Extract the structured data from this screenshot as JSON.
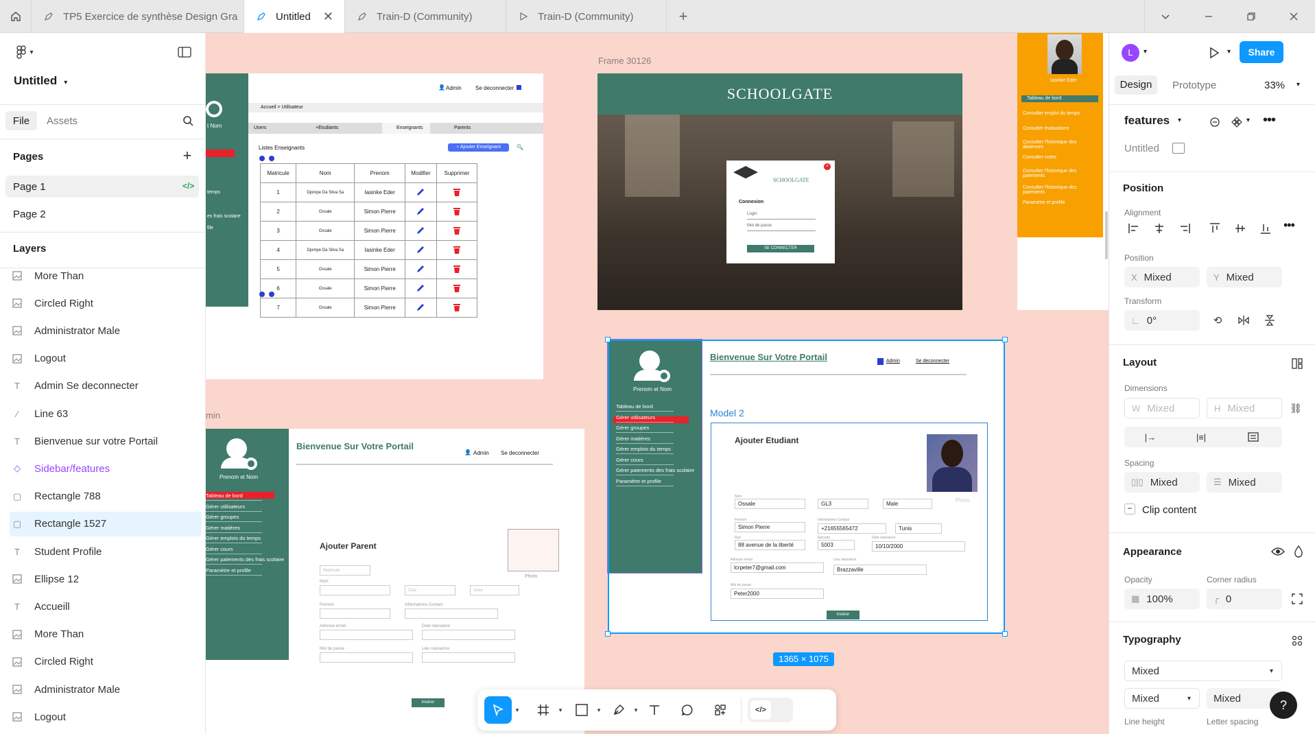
{
  "tabs": [
    {
      "label": "TP5 Exercice de synthèse Design Gra",
      "active": false
    },
    {
      "label": "Untitled",
      "active": true
    },
    {
      "label": "Train-D (Community)",
      "active": false
    },
    {
      "label": "Train-D (Community)",
      "active": false
    }
  ],
  "file": {
    "title": "Untitled"
  },
  "panel_tabs": {
    "file": "File",
    "assets": "Assets"
  },
  "pages": {
    "heading": "Pages",
    "items": [
      "Page 1",
      "Page 2"
    ]
  },
  "layers": {
    "heading": "Layers",
    "items": [
      {
        "label": "More Than",
        "icon": "image"
      },
      {
        "label": "Circled Right",
        "icon": "image"
      },
      {
        "label": "Administrator Male",
        "icon": "image"
      },
      {
        "label": "Logout",
        "icon": "image"
      },
      {
        "label": "Admin Se deconnecter",
        "icon": "text"
      },
      {
        "label": "Line 63",
        "icon": "line"
      },
      {
        "label": "Bienvenue sur votre Portail",
        "icon": "text"
      },
      {
        "label": "Sidebar/features",
        "icon": "component"
      },
      {
        "label": "Rectangle 788",
        "icon": "rect"
      },
      {
        "label": "Rectangle 1527",
        "icon": "rect"
      },
      {
        "label": "Student Profile",
        "icon": "text"
      },
      {
        "label": "Ellipse 12",
        "icon": "image"
      },
      {
        "label": "Accueill",
        "icon": "text"
      },
      {
        "label": "More Than",
        "icon": "image"
      },
      {
        "label": "Circled Right",
        "icon": "image"
      },
      {
        "label": "Administrator Male",
        "icon": "image"
      },
      {
        "label": "Logout",
        "icon": "image"
      }
    ]
  },
  "canvas": {
    "frame_label": "Frame 30126",
    "frame_label_2": "min",
    "size_badge": "1365 × 1075",
    "users_frame": {
      "header_admin": "Admin",
      "header_logout": "Se deconnecter",
      "breadcrumb": "Accueil > Utilisateur",
      "tabs": [
        "Users",
        "+Etudiants",
        "Enseignants",
        "Parents"
      ],
      "list_title": "Listes Enseignants",
      "add_button": "+ Ajouter Enseignant",
      "columns": [
        "Matricule",
        "Nom",
        "Prenom",
        "Modifier",
        "Supprimer"
      ],
      "rows": [
        [
          "1",
          "Djompe Da Silva Sa",
          "Iasinke Eder"
        ],
        [
          "2",
          "Ossale",
          "Simon Pierre"
        ],
        [
          "3",
          "Ossale",
          "Simon Pierre"
        ],
        [
          "4",
          "Djompe Da Silva Sa",
          "Iasinke Eder"
        ],
        [
          "5",
          "Ossale",
          "Simon Pierre"
        ],
        [
          "6",
          "Ossale",
          "Simon Pierre"
        ],
        [
          "7",
          "Ossale",
          "Simon Pierre"
        ]
      ],
      "sidebar_partial": [
        "t Nom",
        "temps",
        "es frais scolaire",
        "file"
      ]
    },
    "schoolgate": {
      "title": "SCHOOLGATE",
      "login_brand": "SCHOOLGATE",
      "login_heading": "Connexion",
      "login_field": "Login",
      "password_field": "Mot de passe",
      "button": "SE CONNECTER"
    },
    "orange": {
      "name": "Iasinke Eder",
      "items": [
        "Tableau de bord",
        "Consulter emploi du temps",
        "Consulter évaluations",
        "Consulter l'historique des absences",
        "Consulter notes",
        "Consulter l'historique des paiements",
        "Consulter l'historique des paiements",
        "Paramètre et profile"
      ]
    },
    "parent_frame": {
      "sidebar_name": "Prenom et Nom",
      "sidebar_items": [
        "Tableau de bord",
        "Gérer utilisateurs",
        "Gérer groupes",
        "Gérer matières",
        "Gérer emplois du temps",
        "Gérer cours",
        "Gérer paiements des frais scolaire",
        "Paramètre et profile"
      ],
      "welcome": "Bienvenue Sur Votre Portail",
      "admin": "Admin",
      "logout": "Se deconnecter",
      "form_title": "Ajouter Parent",
      "matricule_ph": "Matricule",
      "labels": [
        "Nom",
        "Prenom",
        "Informations Contact",
        "Adresse email",
        "Date naissance",
        "Mot de passe",
        "Lieu naissance"
      ],
      "class_ph": "Clas",
      "sexe_ph": "Sexe",
      "photo": "Photo",
      "button": "Insérer"
    },
    "student_frame": {
      "sidebar_name": "Prenom et Nom",
      "sidebar_items": [
        "Tableau de bord",
        "Gérer utilisateurs",
        "Gérer groupes",
        "Gérer matières",
        "Gérer emplois du temps",
        "Gérer cours",
        "Gérer paiements des frais scolaire",
        "Paramètre et profile"
      ],
      "welcome": "Bienvenue Sur Votre Portail",
      "admin": "Admin",
      "logout": "Se deconnecter",
      "model": "Model 2",
      "form_title": "Ajouter Etudiant",
      "photo": "Photo",
      "field_labels": {
        "nom": "Nom",
        "prenom": "Prenom",
        "rue": "Rue",
        "contact": "Informations Contact",
        "epicode": "Epicode",
        "date": "Date naissance",
        "email": "Adresse email",
        "lieu": "Lieu naissance",
        "mdp": "Mot de passe"
      },
      "values": {
        "nom": "Ossale",
        "classe": "GL3",
        "sexe": "Male",
        "prenom": "Simon Pierre",
        "phone": "+21655565472",
        "ville": "Tunis",
        "rue": "88 avenue de la liberté",
        "code": "5003",
        "date": "10/10/2000",
        "email": "lcrpeter7@gmail.com",
        "lieu": "Brazzaville",
        "mdp": "Peter2000"
      },
      "button": "Insérer"
    }
  },
  "right_panel": {
    "avatar_letter": "L",
    "share": "Share",
    "tabs": {
      "design": "Design",
      "prototype": "Prototype"
    },
    "zoom": "33%",
    "component_name": "features",
    "component_sub": "Untitled",
    "position_title": "Position",
    "alignment_label": "Alignment",
    "position_label": "Position",
    "x_label": "X",
    "x_value": "Mixed",
    "y_label": "Y",
    "y_value": "Mixed",
    "transform_label": "Transform",
    "rotation": "0°",
    "layout_title": "Layout",
    "dimensions_label": "Dimensions",
    "w_label": "W",
    "w_value": "Mixed",
    "h_label": "H",
    "h_value": "Mixed",
    "spacing_label": "Spacing",
    "spacing_h": "Mixed",
    "spacing_v": "Mixed",
    "clip_content": "Clip content",
    "appearance_title": "Appearance",
    "opacity_label": "Opacity",
    "opacity_value": "100%",
    "radius_label": "Corner radius",
    "radius_value": "0",
    "typography_title": "Typography",
    "font_value": "Mixed",
    "style_value": "Mixed",
    "size_value": "Mixed",
    "line_height_label": "Line height",
    "letter_spacing_label": "Letter spacing",
    "help": "?"
  },
  "colors": {
    "accent": "#0d99ff",
    "sidebar_green": "#3f7a6b",
    "canvas_bg": "#fbd6cc",
    "orange": "#f7a000",
    "red": "#e8212a"
  }
}
